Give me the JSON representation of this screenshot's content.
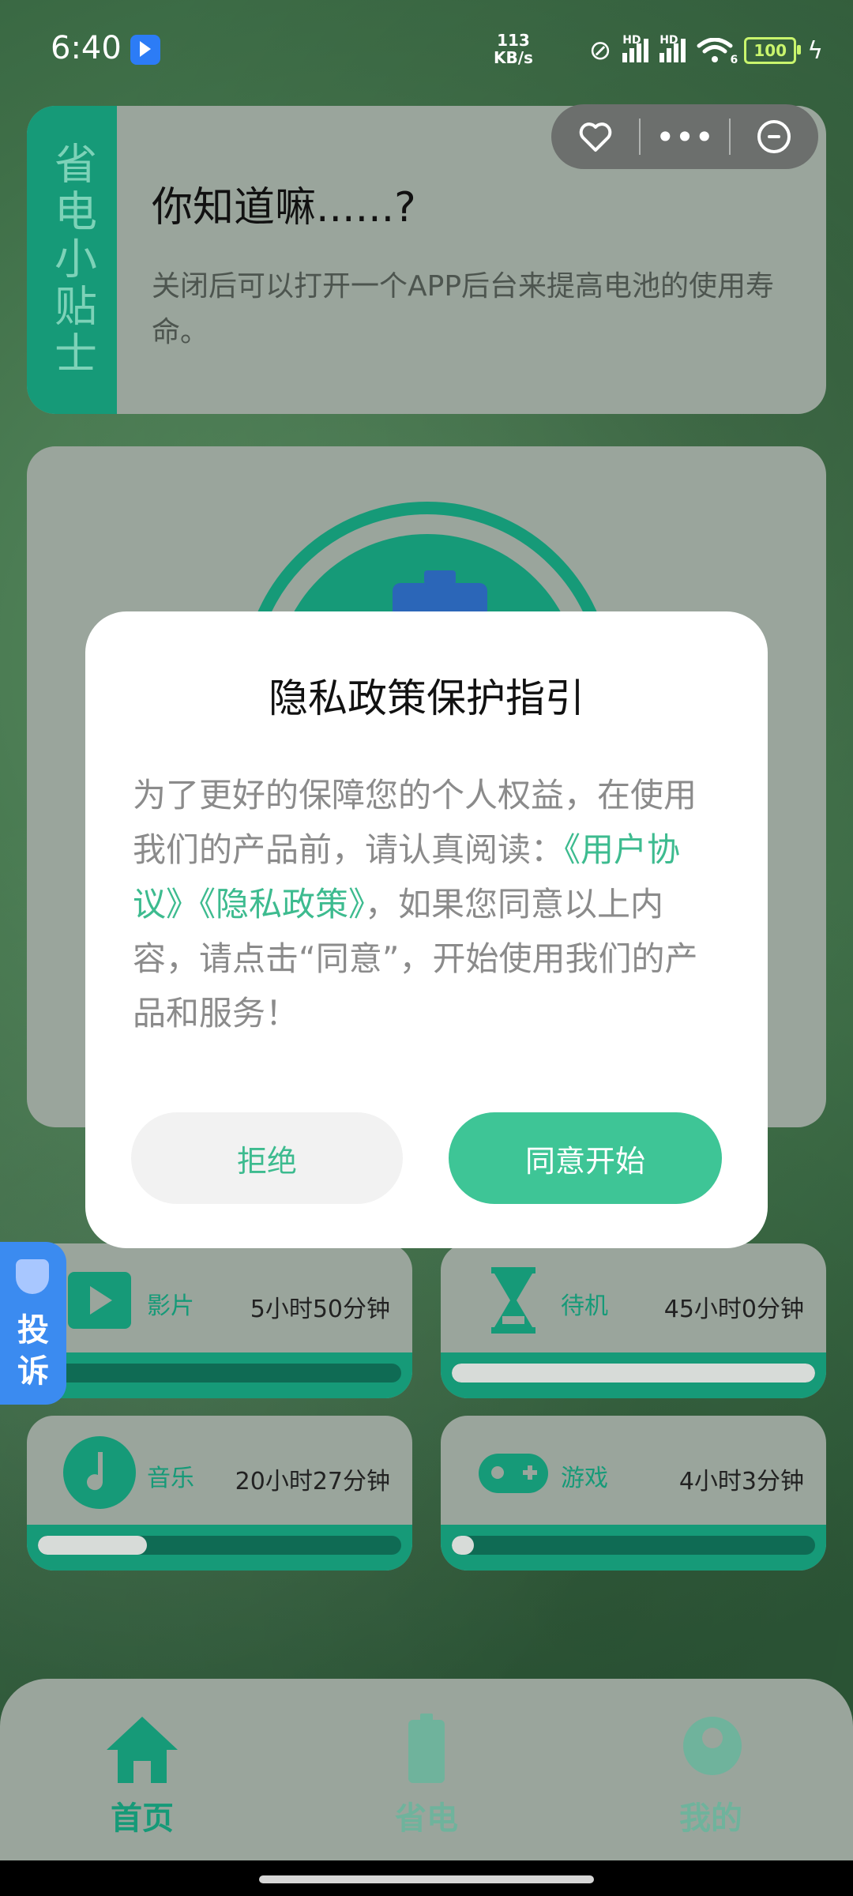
{
  "status_bar": {
    "time": "6:40",
    "net_speed_value": "113",
    "net_speed_unit": "KB/s",
    "signal1_label": "HD",
    "signal2_label": "HD",
    "wifi_label": "6",
    "battery": "100"
  },
  "mini_program_capsule": {
    "favorite_icon": "heart-icon",
    "more_icon": "more-dots-icon",
    "close_icon": "minus-circle-icon"
  },
  "tips_card": {
    "side_label": "省电小贴士",
    "title": "你知道嘛......?",
    "body": "关闭后可以打开一个APP后台来提高电池的使用寿命。"
  },
  "usage_stats": [
    {
      "label": "影片",
      "time": "5小时50分钟",
      "progress_percent": 4,
      "icon": "play-icon"
    },
    {
      "label": "待机",
      "time": "45小时0分钟",
      "progress_percent": 100,
      "icon": "hourglass-icon"
    },
    {
      "label": "音乐",
      "time": "20小时27分钟",
      "progress_percent": 30,
      "icon": "music-note-icon"
    },
    {
      "label": "游戏",
      "time": "4小时3分钟",
      "progress_percent": 6,
      "icon": "gamepad-icon"
    }
  ],
  "complaint": {
    "label": "投诉"
  },
  "bottom_nav": {
    "home": "首页",
    "save": "省电",
    "me": "我的"
  },
  "dialog": {
    "title": "隐私政策保护指引",
    "body_part1": "为了更好的保障您的个人权益，在使用我们的产品前，请认真阅读：",
    "link_user_agreement": "《用户协议》",
    "link_privacy_policy": "《隐私政策》",
    "body_part2": "，如果您同意以上内容，请点击“同意”，开始使用我们的产品和服务！",
    "reject_label": "拒绝",
    "accept_label": "同意开始"
  },
  "colors": {
    "primary_green": "#169a78",
    "accent_green": "#3ec596",
    "card_gray": "#9aa59c",
    "complaint_blue": "#3b8bf0"
  }
}
